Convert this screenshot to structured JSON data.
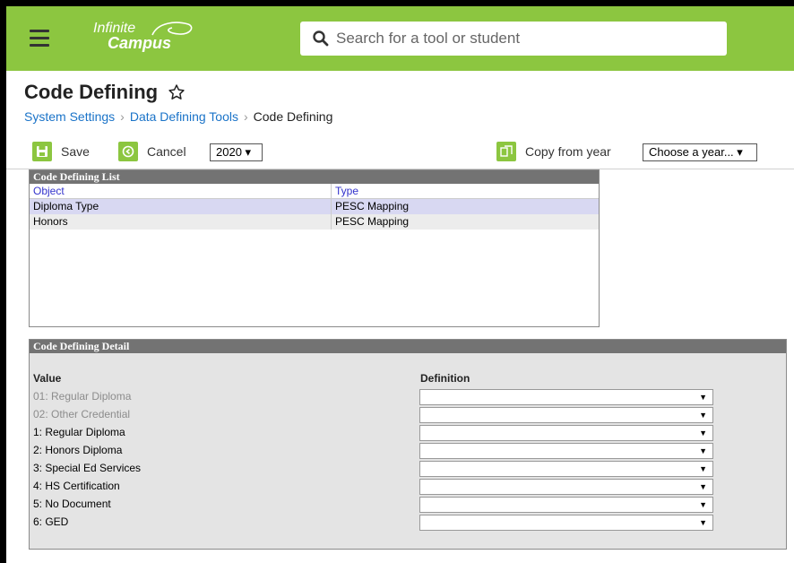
{
  "app": {
    "logo_line1": "Infinite",
    "logo_line2": "Campus",
    "search_placeholder": "Search for a tool or student",
    "brand_color": "#8cc640"
  },
  "page": {
    "title": "Code Defining",
    "breadcrumb": [
      "System Settings",
      "Data Defining Tools",
      "Code Defining"
    ]
  },
  "toolbar": {
    "save_label": "Save",
    "cancel_label": "Cancel",
    "year_value": "2020 ▾",
    "copy_label": "Copy from year",
    "choose_year_value": "Choose a year... ▾"
  },
  "list": {
    "heading": "Code Defining List",
    "columns": [
      "Object",
      "Type"
    ],
    "rows": [
      {
        "object": "Diploma Type",
        "type": "PESC Mapping"
      },
      {
        "object": "Honors",
        "type": "PESC Mapping"
      }
    ]
  },
  "detail": {
    "heading": "Code Defining Detail",
    "value_header": "Value",
    "definition_header": "Definition",
    "rows": [
      {
        "value": "01: Regular Diploma",
        "definition": ""
      },
      {
        "value": "02: Other Credential",
        "definition": ""
      },
      {
        "value": "1: Regular Diploma",
        "definition": ""
      },
      {
        "value": "2: Honors Diploma",
        "definition": ""
      },
      {
        "value": "3: Special Ed Services",
        "definition": ""
      },
      {
        "value": "4: HS Certification",
        "definition": ""
      },
      {
        "value": "5: No Document",
        "definition": ""
      },
      {
        "value": "6: GED",
        "definition": ""
      }
    ]
  }
}
